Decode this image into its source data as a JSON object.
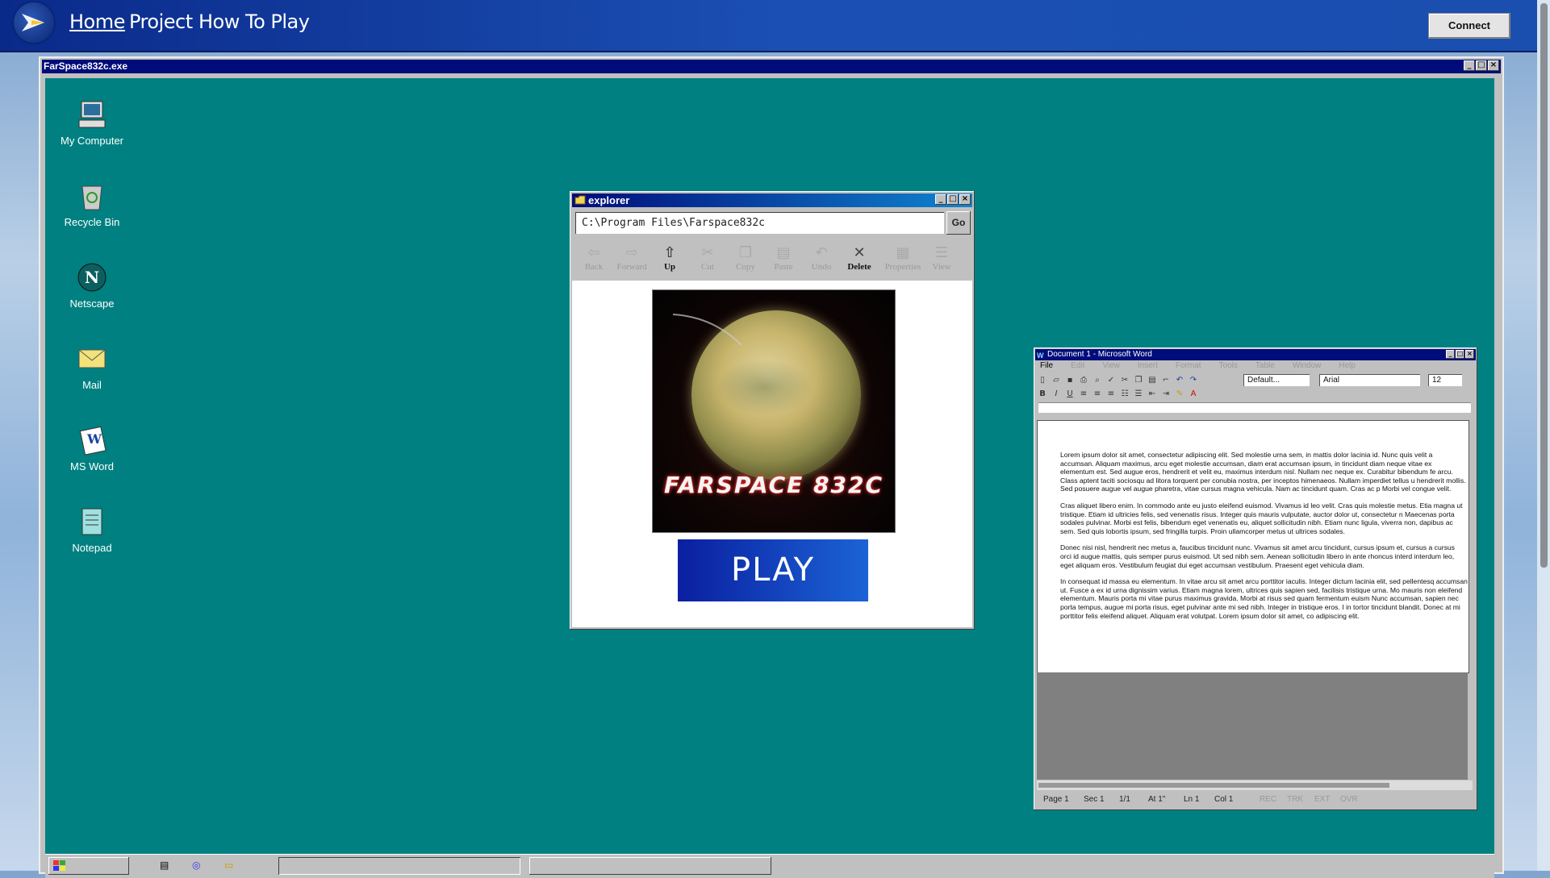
{
  "nav": {
    "links": [
      "Home",
      "Project",
      "How To Play"
    ],
    "connect_label": "Connect"
  },
  "app_window": {
    "title": "FarSpace832c.exe"
  },
  "desktop_icons": [
    {
      "label": "My Computer",
      "icon": "computer-icon"
    },
    {
      "label": "Recycle Bin",
      "icon": "recycle-bin-icon"
    },
    {
      "label": "Netscape",
      "icon": "netscape-icon"
    },
    {
      "label": "Mail",
      "icon": "mail-icon"
    },
    {
      "label": "MS Word",
      "icon": "word-icon"
    },
    {
      "label": "Notepad",
      "icon": "notepad-icon"
    }
  ],
  "explorer": {
    "title": "explorer",
    "address": "C:\\Program Files\\Farspace832c",
    "go_label": "Go",
    "toolbar": [
      {
        "label": "Back",
        "icon": "back-arrow-icon",
        "enabled": false
      },
      {
        "label": "Forward",
        "icon": "forward-arrow-icon",
        "enabled": false
      },
      {
        "label": "Up",
        "icon": "folder-up-icon",
        "enabled": true
      },
      {
        "label": "Cut",
        "icon": "scissors-icon",
        "enabled": false
      },
      {
        "label": "Copy",
        "icon": "copy-icon",
        "enabled": false
      },
      {
        "label": "Paste",
        "icon": "paste-icon",
        "enabled": false
      },
      {
        "label": "Undo",
        "icon": "undo-icon",
        "enabled": false
      },
      {
        "label": "Delete",
        "icon": "delete-x-icon",
        "enabled": true
      },
      {
        "label": "Properties",
        "icon": "properties-icon",
        "enabled": false
      },
      {
        "label": "View",
        "icon": "view-icon",
        "enabled": false
      }
    ],
    "game_logo": "FARSPACE 832C",
    "play_label": "PLAY"
  },
  "word": {
    "title": "Document 1 - Microsoft Word",
    "menu": [
      "File",
      "Edit",
      "View",
      "Insert",
      "Format",
      "Tools",
      "Table",
      "Window",
      "Help"
    ],
    "style": "Default...",
    "font": "Arial",
    "size": "12",
    "paragraphs": [
      "Lorem ipsum dolor sit amet, consectetur adipiscing elit. Sed molestie urna sem, in mattis dolor lacinia id. Nunc quis velit a accumsan. Aliquam maximus, arcu eget molestie accumsan, diam erat accumsan ipsum, in tincidunt diam neque vitae ex elementum est. Sed augue eros, hendrerit et velit eu, maximus interdum nisl. Nullam nec neque ex. Curabitur bibendum fe arcu. Class aptent taciti sociosqu ad litora torquent per conubia nostra, per inceptos himenaeos. Nullam imperdiet tellus u hendrerit mollis. Sed posuere augue vel augue pharetra, vitae cursus magna vehicula. Nam ac tincidunt quam. Cras ac p Morbi vel congue velit.",
      "Cras aliquet libero enim. In commodo ante eu justo eleifend euismod. Vivamus id leo velit. Cras quis molestie metus. Etia magna ut tristique. Etiam id ultricies felis, sed venenatis risus. Integer quis mauris vulputate, auctor dolor ut, consectetur n Maecenas porta sodales pulvinar. Morbi est felis, bibendum eget venenatis eu, aliquet sollicitudin nibh. Etiam nunc ligula, viverra non, dapibus ac sem. Sed quis lobortis ipsum, sed fringilla turpis. Proin ullamcorper metus ut ultrices sodales.",
      "Donec nisi nisl, hendrerit nec metus a, faucibus tincidunt nunc. Vivamus sit amet arcu tincidunt, cursus ipsum et, cursus a cursus orci id augue mattis, quis semper purus euismod. Ut sed nibh sem. Aenean sollicitudin libero in ante rhoncus interd interdum leo, eget aliquam eros. Vestibulum feugiat dui eget accumsan vestibulum. Praesent eget vehicula diam.",
      "In consequat id massa eu elementum. In vitae arcu sit amet arcu porttitor iaculis. Integer dictum lacinia elit, sed pellentesq accumsan ut. Fusce a ex id urna dignissim varius. Etiam magna lorem, ultrices quis sapien sed, facilisis tristique urna. Mo mauris non eleifend elementum. Mauris porta mi vitae purus maximus gravida. Morbi at risus sed quam fermentum euism Nunc accumsan, sapien nec porta tempus, augue mi porta risus, eget pulvinar ante mi sed nibh. Integer in tristique eros. I in tortor tincidunt blandit. Donec at mi porttitor felis eleifend aliquet. Aliquam erat volutpat. Lorem ipsum dolor sit amet, co adipiscing elit."
    ],
    "status": {
      "page": "Page 1",
      "sec": "Sec 1",
      "pages": "1/1",
      "at": "At 1\"",
      "ln": "Ln 1",
      "col": "Col 1",
      "rec": "REC",
      "trk": "TRK",
      "ext": "EXT",
      "ovr": "OVR"
    }
  }
}
